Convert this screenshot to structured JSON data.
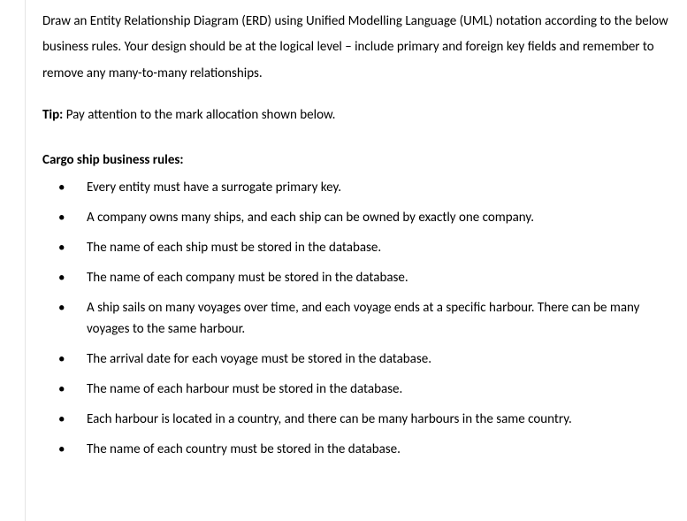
{
  "intro": {
    "paragraph": "Draw an Entity Relationship Diagram (ERD) using Unified Modelling Language (UML) notation according to the below business rules. Your design should be at the logical level – include primary and foreign key fields and remember to remove any many-to-many relationships."
  },
  "tip": {
    "label": "Tip:",
    "text": " Pay attention to the mark allocation shown below."
  },
  "section_heading": "Cargo ship business rules:",
  "rules": [
    "Every entity must have a surrogate primary key.",
    "A company owns many ships, and each ship can be owned by exactly one company.",
    "The name of each ship must be stored in the database.",
    "The name of each company must be stored in the database.",
    "A ship sails on many voyages over time, and each voyage ends at a specific harbour. There can be many voyages to the same harbour.",
    "The arrival date for each voyage must be stored in the database.",
    "The name of each harbour must be stored in the database.",
    "Each harbour is located in a country, and there can be many harbours in the same country.",
    "The name of each country must be stored in the database."
  ]
}
